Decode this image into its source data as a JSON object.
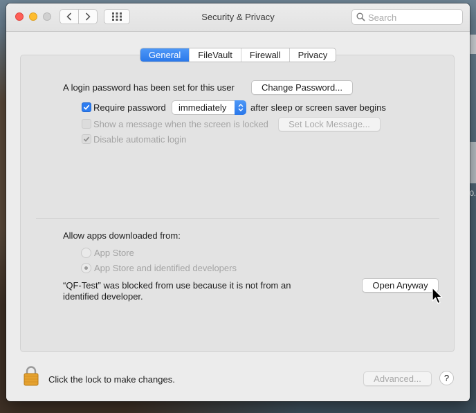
{
  "window": {
    "title": "Security & Privacy"
  },
  "search": {
    "placeholder": "Search"
  },
  "tabs": [
    {
      "label": "General",
      "active": true
    },
    {
      "label": "FileVault",
      "active": false
    },
    {
      "label": "Firewall",
      "active": false
    },
    {
      "label": "Privacy",
      "active": false
    }
  ],
  "general": {
    "login_message": "A login password has been set for this user",
    "change_password_label": "Change Password...",
    "require_password": {
      "label": "Require password",
      "checked": true,
      "value": "immediately",
      "suffix": "after sleep or screen saver begins"
    },
    "show_message": {
      "label": "Show a message when the screen is locked",
      "checked": false,
      "enabled": false,
      "button_label": "Set Lock Message..."
    },
    "disable_auto_login": {
      "label": "Disable automatic login",
      "checked": true,
      "enabled": false
    },
    "allow_apps_heading": "Allow apps downloaded from:",
    "allow_options": [
      {
        "label": "App Store",
        "selected": false
      },
      {
        "label": "App Store and identified developers",
        "selected": true
      }
    ],
    "blocked_message_line1": "“QF-Test” was blocked from use because it is not from an",
    "blocked_message_line2": "identified developer.",
    "open_anyway_label": "Open Anyway"
  },
  "footer": {
    "lock_message": "Click the lock to make changes.",
    "advanced_label": "Advanced...",
    "help_label": "?"
  },
  "desktop": {
    "partial_label": "0."
  },
  "colors": {
    "accent": "#2d7cf0",
    "window_bg": "#ececec",
    "panel_bg": "#e3e3e3"
  }
}
